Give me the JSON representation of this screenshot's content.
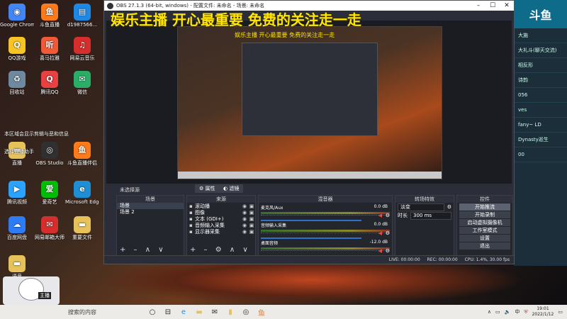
{
  "overlay": {
    "broadcast_text": "娱乐主播 开心最重要 免费的关注走一走",
    "nested_text": "娱乐主播 开心最重要 免费的关注走一走"
  },
  "desktop": {
    "icons": [
      {
        "label": "Google Chrome",
        "icon": "chrome-icon",
        "glyph": "◉",
        "color": "#4285f4"
      },
      {
        "label": "斗鱼直播",
        "icon": "douyu-icon",
        "glyph": "鱼",
        "color": "#ff7a1a"
      },
      {
        "label": "d1987566...",
        "icon": "document-icon",
        "glyph": "▤",
        "color": "#1e88e5"
      },
      {
        "label": "QQ游戏",
        "icon": "qq-game-icon",
        "glyph": "Q",
        "color": "#f6c524"
      },
      {
        "label": "喜马拉雅",
        "icon": "ximalaya-icon",
        "glyph": "听",
        "color": "#f25a37"
      },
      {
        "label": "网易云音乐",
        "icon": "netease-music-icon",
        "glyph": "♫",
        "color": "#d62d2d"
      },
      {
        "label": "回收站",
        "icon": "recycle-bin-icon",
        "glyph": "♻",
        "color": "#6f8aa0"
      },
      {
        "label": "腾讯QQ",
        "icon": "qq-icon",
        "glyph": "Q",
        "color": "#e94141"
      },
      {
        "label": "微信",
        "icon": "wechat-icon",
        "glyph": "✉",
        "color": "#2aae67"
      },
      {
        "label": "取消使用斗鱼直播助手",
        "icon": "shortcut-icon",
        "glyph": "▦",
        "color": "#c03b3b"
      },
      {
        "label": "直播",
        "icon": "folder-icon",
        "glyph": "▬",
        "color": "#e7c25b"
      },
      {
        "label": "OBS Studio",
        "icon": "obs-icon",
        "glyph": "◎",
        "color": "#303030"
      },
      {
        "label": "斗鱼直播伴侣",
        "icon": "douyu-companion-icon",
        "glyph": "鱼",
        "color": "#ff7a1a"
      },
      {
        "label": "腾讯视频",
        "icon": "tencent-video-icon",
        "glyph": "▶",
        "color": "#2aa2ff"
      },
      {
        "label": "爱奇艺",
        "icon": "iqiyi-icon",
        "glyph": "爱",
        "color": "#00be06"
      },
      {
        "label": "Microsoft Edge",
        "icon": "edge-icon",
        "glyph": "e",
        "color": "#1e8fd6"
      },
      {
        "label": "百度网盘",
        "icon": "baidu-pan-icon",
        "glyph": "☁",
        "color": "#2d7cf6"
      },
      {
        "label": "网易邮箱大师",
        "icon": "netease-mail-icon",
        "glyph": "✉",
        "color": "#d62d2d"
      },
      {
        "label": "重要文件",
        "icon": "folder-icon",
        "glyph": "▬",
        "color": "#e7c25b"
      },
      {
        "label": "语音",
        "icon": "folder-icon",
        "glyph": "▬",
        "color": "#e7c25b"
      }
    ],
    "desktop_text_1": "本区域会显示剪辑与恶和信息",
    "desktop_text_2": "选择直播助手"
  },
  "obs": {
    "title": "OBS 27.1.3 (64-bit, windows) - 配置文件: 未命名 - 场景: 未命名",
    "no_source_label": "未选择源",
    "properties_btn": "属性",
    "filters_btn": "滤镜",
    "scenes": {
      "title": "场景",
      "items": [
        "场景",
        "场景 2"
      ]
    },
    "sources": {
      "title": "来源",
      "items": [
        {
          "name": "滚动播",
          "icon": "window-capture-icon"
        },
        {
          "name": "图像",
          "icon": "image-icon"
        },
        {
          "name": "文本 (GDI+)",
          "icon": "text-icon"
        },
        {
          "name": "音频输入采集",
          "icon": "mic-icon"
        },
        {
          "name": "显示器采集",
          "icon": "monitor-icon"
        }
      ]
    },
    "mixer": {
      "title": "混音器",
      "channels": [
        {
          "name": "麦克风/Aux",
          "db": "0.0 dB"
        },
        {
          "name": "音频输入采集",
          "db": "0.0 dB"
        },
        {
          "name": "桌面音频",
          "db": "-12.0 dB"
        }
      ]
    },
    "transitions": {
      "title": "转场特效",
      "type": "淡变",
      "duration_label": "时长",
      "duration_value": "300 ms"
    },
    "controls": {
      "title": "控件",
      "buttons": [
        "开始推流",
        "开始录制",
        "启动虚拟摄像机",
        "工作室模式",
        "设置",
        "退出"
      ]
    },
    "status": {
      "live": "LIVE: 00:00:00",
      "rec": "REC: 00:00:00",
      "cpu": "CPU: 1.4%, 30.00 fps"
    }
  },
  "right_app": {
    "items": [
      "大施",
      "大礼斗(聊天交流)",
      "相反形",
      "诗韵",
      "056",
      "ves",
      "fany~ LD",
      "Dynasty巡生",
      "00"
    ]
  },
  "webcam": {
    "badge": "主播"
  },
  "taskbar": {
    "search_placeholder": "搜索的内容",
    "clock_time": "19:01",
    "clock_date": "2022/1/12",
    "ime": "中"
  }
}
